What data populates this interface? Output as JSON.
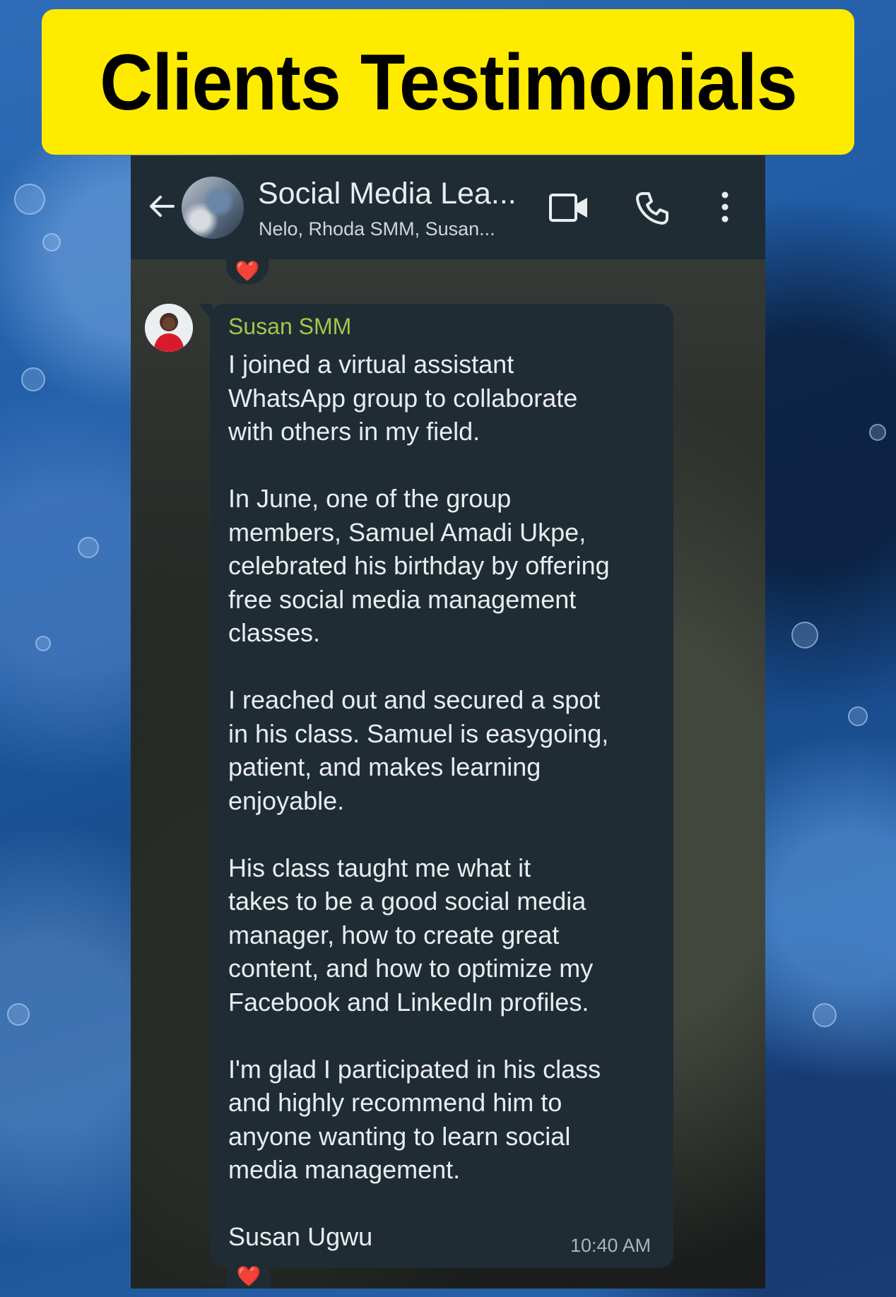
{
  "banner": {
    "title": "Clients Testimonials"
  },
  "chat_header": {
    "title": "Social Media Lea...",
    "subtitle": "Nelo, Rhoda SMM, Susan...",
    "icons": [
      "back-arrow-icon",
      "group-avatar",
      "video-call-icon",
      "voice-call-icon",
      "more-options-icon"
    ]
  },
  "reactions": {
    "top": "❤️",
    "bottom": "❤️"
  },
  "message": {
    "sender": "Susan SMM",
    "body": "I joined a virtual assistant\nWhatsApp group to collaborate\nwith others in my field.\n\nIn June, one of the group\nmembers, Samuel Amadi Ukpe,\ncelebrated his birthday by offering\nfree social media management\nclasses.\n\nI reached out and secured a spot\nin his class. Samuel is easygoing,\npatient, and makes learning\nenjoyable.\n\nHis class taught me what it\ntakes to be a good social media\nmanager, how to create great\ncontent, and how to optimize my\nFacebook and LinkedIn profiles.\n\nI'm glad I participated in his class\nand highly recommend him to\nanyone wanting to learn social\nmedia management.\n\nSusan Ugwu",
    "time": "10:40 AM"
  },
  "colors": {
    "banner_bg": "#ffeb00",
    "header_bg": "#1f2c34",
    "bubble_bg": "#1f2c34",
    "sender_name": "#a2c64d",
    "text": "#e9edef",
    "heart": "#e83646"
  }
}
